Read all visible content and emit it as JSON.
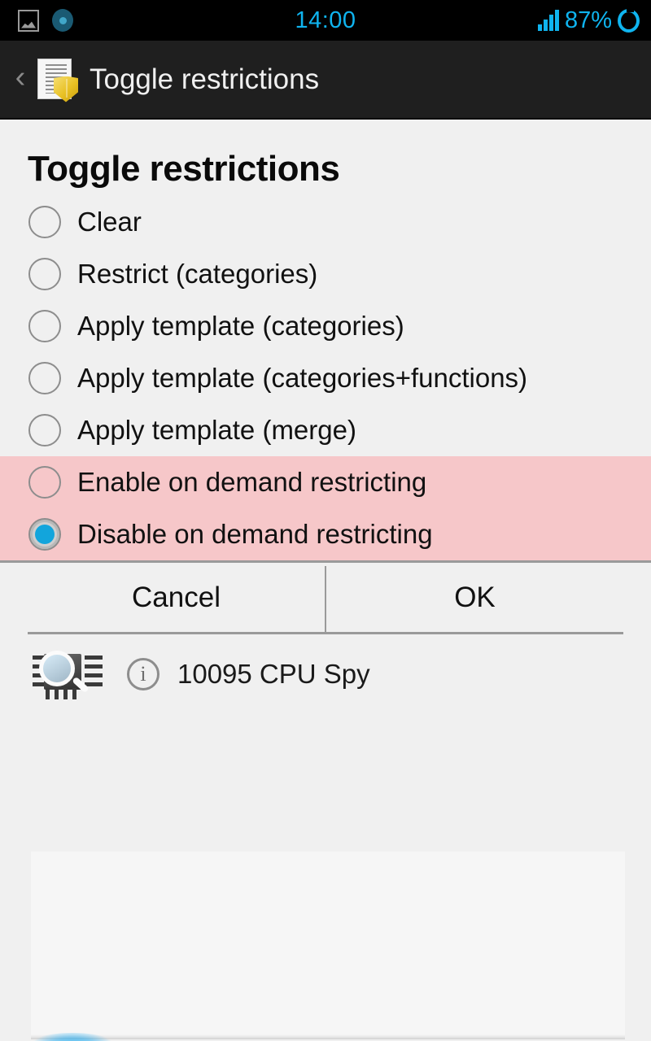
{
  "status_bar": {
    "time": "14:00",
    "battery_percent": "87%",
    "icons": {
      "screenshot": "image-icon",
      "sync": "circle-disc-icon",
      "signal": "signal-bars-icon",
      "battery": "battery-ring-icon"
    },
    "accent_color": "#0fb4ef",
    "background_color": "#000000"
  },
  "app_bar": {
    "back_label": "‹",
    "app_icon": "document-shield-icon",
    "title": "Toggle restrictions",
    "background_color": "#1f1f1f",
    "text_color": "#f0f0f0"
  },
  "dialog": {
    "title": "Toggle restrictions",
    "highlight_color": "#f6c7c9",
    "selected_radio_color": "#12a5dc",
    "options": [
      {
        "label": "Clear",
        "selected": false,
        "highlighted": false
      },
      {
        "label": "Restrict (categories)",
        "selected": false,
        "highlighted": false
      },
      {
        "label": "Apply template (categories)",
        "selected": false,
        "highlighted": false
      },
      {
        "label": "Apply template (categories+functions)",
        "selected": false,
        "highlighted": false
      },
      {
        "label": "Apply template (merge)",
        "selected": false,
        "highlighted": false
      },
      {
        "label": "Enable on demand restricting",
        "selected": false,
        "highlighted": true
      },
      {
        "label": "Disable on demand restricting",
        "selected": true,
        "highlighted": true
      }
    ],
    "buttons": {
      "cancel": "Cancel",
      "ok": "OK"
    }
  },
  "app_list": {
    "items": [
      {
        "icon": "cpu-spy-icon",
        "info_icon": "info-icon",
        "info_glyph": "i",
        "label": "10095 CPU Spy"
      }
    ]
  }
}
